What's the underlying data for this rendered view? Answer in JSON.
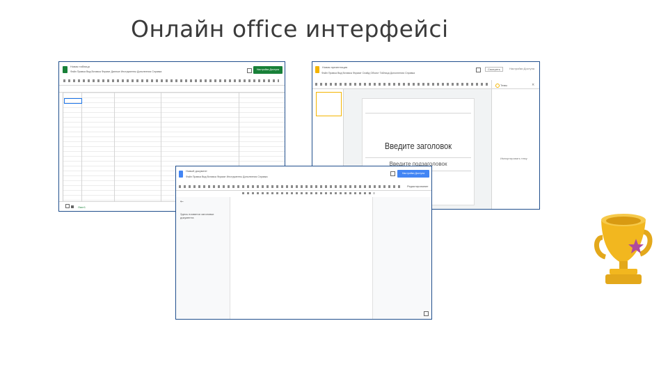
{
  "slide": {
    "title": "Онлайн office интерфейсі"
  },
  "sheets": {
    "doc_title": "Новая таблица",
    "menu": "Файл Правка Вид Вставка Формат Данные Инструменты Дополнения Справка",
    "access_button": "Настройки Доступа",
    "sheet_tab": "Лист1"
  },
  "slides": {
    "doc_title": "Новая презентация",
    "menu": "Файл Правка Вид Вставка Формат Слайд Объект Таблица Дополнения Справка",
    "present_button": "Смотреть",
    "access_button": "Настройки Доступа",
    "slide_title_placeholder": "Введите заголовок",
    "slide_subtitle_placeholder": "Введите подзаголовок",
    "theme_label": "Темы",
    "import_theme": "Импортировать тему"
  },
  "docs": {
    "doc_title": "Новый документ",
    "menu": "Файл Правка Вид Вставка Формат Инструменты Дополнения Справка",
    "access_button": "Настройки Доступа",
    "outline_text": "Здесь появятся заголовки документа",
    "edit_mode": "Редактирование"
  },
  "colors": {
    "sheets_green": "#188038",
    "slides_yellow": "#f4b400",
    "docs_blue": "#4285f4",
    "frame_blue": "#1f4e8c"
  },
  "decor": {
    "icon": "trophy-icon"
  }
}
